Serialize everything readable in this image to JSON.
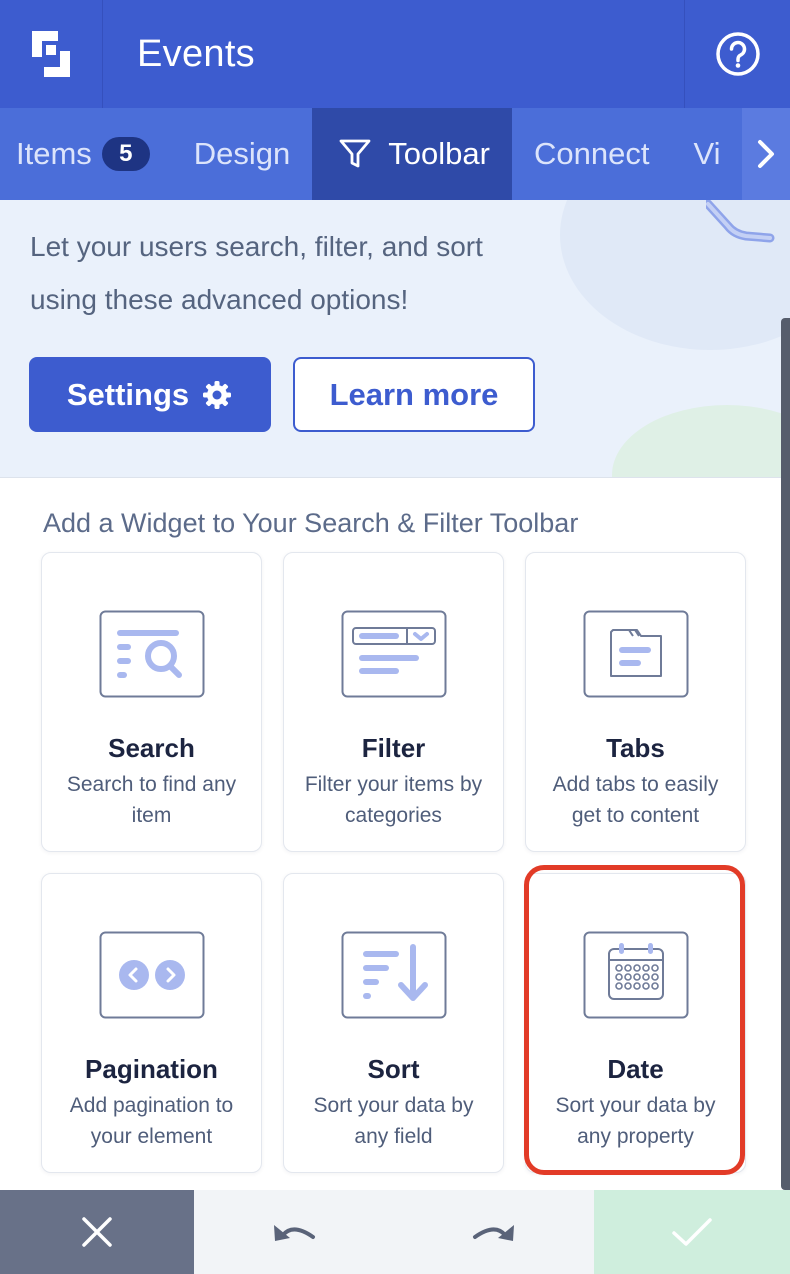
{
  "header": {
    "title": "Events",
    "logo_icon": "app-logo-icon",
    "help_icon": "help-circle-icon"
  },
  "tabs": {
    "items": [
      {
        "label": "Items",
        "badge": "5"
      },
      {
        "label": "Design"
      },
      {
        "label": "Toolbar",
        "icon": "filter-icon",
        "active": true
      },
      {
        "label": "Connect"
      },
      {
        "label": "Vi"
      }
    ],
    "next_icon": "chevron-right-icon"
  },
  "hero": {
    "line1": "Let your users search, filter, and sort",
    "line2": "using these advanced options!",
    "settings_label": "Settings",
    "learn_more_label": "Learn more"
  },
  "widgets": {
    "heading": "Add a Widget to Your Search & Filter Toolbar",
    "items": [
      {
        "name": "Search",
        "desc1": "Search to find any",
        "desc2": "item",
        "icon": "search-widget-icon"
      },
      {
        "name": "Filter",
        "desc1": "Filter your items by",
        "desc2": "categories",
        "icon": "filter-widget-icon"
      },
      {
        "name": "Tabs",
        "desc1": "Add tabs to easily",
        "desc2": "get to content",
        "icon": "tabs-widget-icon"
      },
      {
        "name": "Pagination",
        "desc1": "Add pagination to",
        "desc2": "your element",
        "icon": "pagination-widget-icon"
      },
      {
        "name": "Sort",
        "desc1": "Sort your data by",
        "desc2": "any field",
        "icon": "sort-widget-icon"
      },
      {
        "name": "Date",
        "desc1": "Sort your data by",
        "desc2": "any property",
        "icon": "calendar-widget-icon",
        "highlighted": true
      }
    ]
  },
  "bottom_bar": {
    "close_icon": "close-icon",
    "undo_icon": "undo-icon",
    "redo_icon": "redo-icon",
    "confirm_icon": "check-icon"
  },
  "colors": {
    "primary": "#3d5ccf",
    "tab_bar": "#4b6ed9",
    "active_tab": "#2f4aa8",
    "highlight": "#e23b27",
    "confirm_bg": "#cfeedd"
  }
}
